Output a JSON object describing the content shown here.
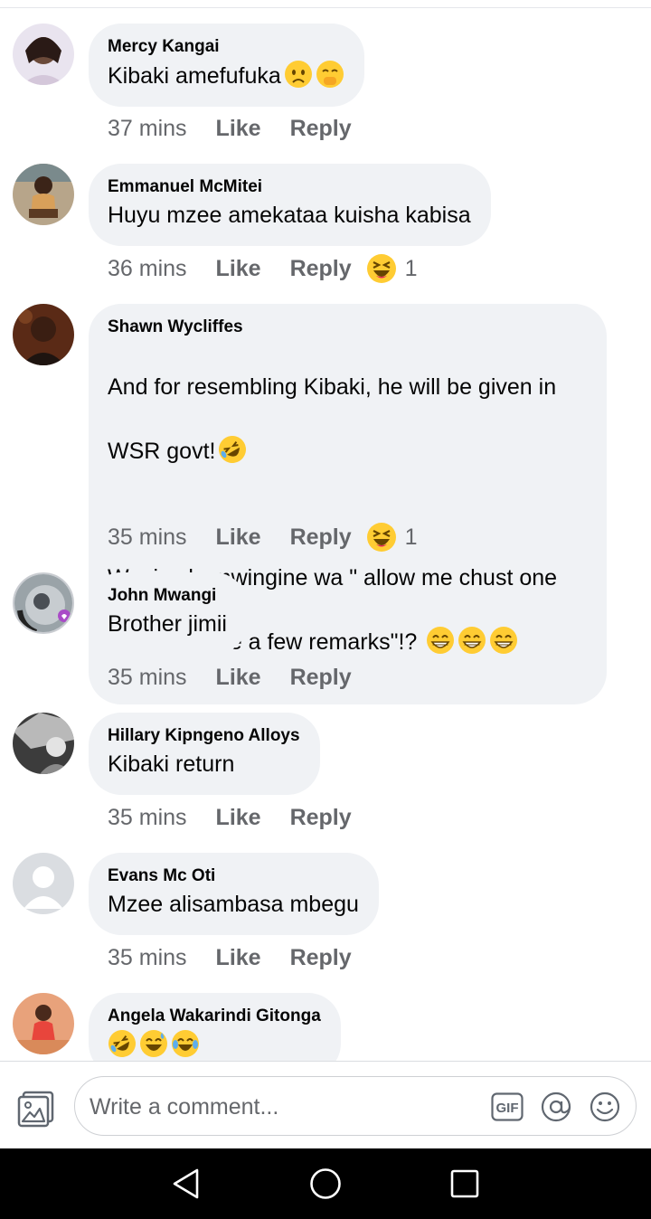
{
  "comments": [
    {
      "author": "Mercy Kangai",
      "text": "Kibaki amefufuka",
      "emojis": [
        "worried-face-emoji",
        "face-with-hand-over-mouth-emoji"
      ],
      "time": "37 mins",
      "like_label": "Like",
      "reply_label": "Reply"
    },
    {
      "author": "Emmanuel McMitei",
      "text": "Huyu mzee amekataa kuisha kabisa",
      "emojis": [],
      "time": "36 mins",
      "like_label": "Like",
      "reply_label": "Reply",
      "reaction": {
        "icon": "laughing-squinting-face-emoji",
        "count": "1"
      }
    },
    {
      "author": "Shawn Wycliffes",
      "text_line1": "And for resembling Kibaki, he will be given in",
      "text_line2": "WSR govt!",
      "text_line3": "Wapi yule mwingine wa \" allow me chust one",
      "text_line4": "minit to make a few remarks\"!?",
      "emojis_line2": [
        "rolling-on-floor-laughing-emoji"
      ],
      "emojis_line4": [
        "beaming-face-emoji",
        "beaming-face-emoji",
        "beaming-face-emoji"
      ],
      "time": "35 mins",
      "like_label": "Like",
      "reply_label": "Reply",
      "reaction": {
        "icon": "laughing-squinting-face-emoji",
        "count": "1"
      }
    },
    {
      "author": "John Mwangi",
      "text": "Brother jimii",
      "emojis": [],
      "time": "35 mins",
      "like_label": "Like",
      "reply_label": "Reply"
    },
    {
      "author": "Hillary Kipngeno Alloys",
      "text": "Kibaki return",
      "emojis": [],
      "time": "35 mins",
      "like_label": "Like",
      "reply_label": "Reply"
    },
    {
      "author": "Evans Mc Oti",
      "text": "Mzee alisambasa mbegu",
      "emojis": [],
      "time": "35 mins",
      "like_label": "Like",
      "reply_label": "Reply"
    },
    {
      "author": "Angela Wakarindi Gitonga",
      "text": "",
      "emojis": [
        "rolling-on-floor-laughing-emoji",
        "grinning-sweat-emoji",
        "face-with-tears-of-joy-emoji"
      ]
    }
  ],
  "composer": {
    "placeholder": "Write a comment...",
    "photo_icon": "photo-icon",
    "gif_label": "GIF",
    "mention_icon": "at-icon",
    "emoji_icon": "smiley-icon"
  },
  "navbar": {
    "back_icon": "back-triangle-icon",
    "home_icon": "home-circle-icon",
    "recents_icon": "recents-square-icon"
  },
  "colors": {
    "bubble_bg": "#f0f2f5",
    "meta_text": "#65676b",
    "emoji_yellow": "#ffcc33",
    "navbar_bg": "#000000"
  }
}
